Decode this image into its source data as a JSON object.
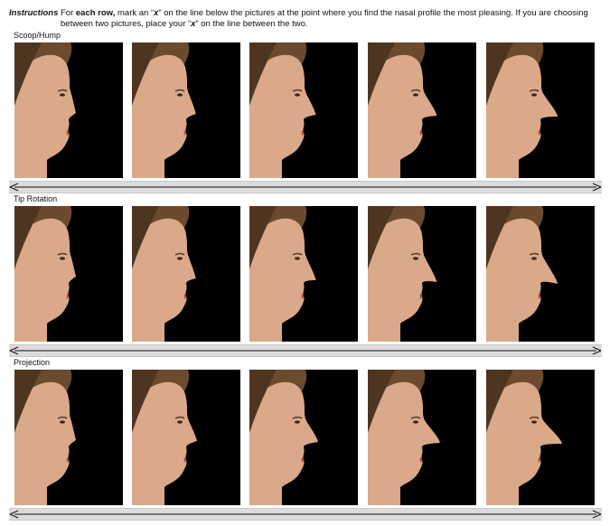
{
  "instructions": {
    "label": "Instructions",
    "part1": "For ",
    "bold1": "each row,",
    "part2": " mark an “",
    "bold2": "x",
    "part3": "” on the line below the pictures at the point where you find the nasal profile the most pleasing. If you are choosing between two pictures, place your “",
    "bold3": "x",
    "part4": "” on the line between the two."
  },
  "rows": [
    {
      "label": "Scoop/Hump"
    },
    {
      "label": "Tip Rotation"
    },
    {
      "label": "Projection"
    }
  ],
  "colors": {
    "photo_bg": "#000000",
    "skin": "#d9a98a",
    "hair": "#6b4a2e",
    "scale_bar": "#dcdcdc"
  }
}
